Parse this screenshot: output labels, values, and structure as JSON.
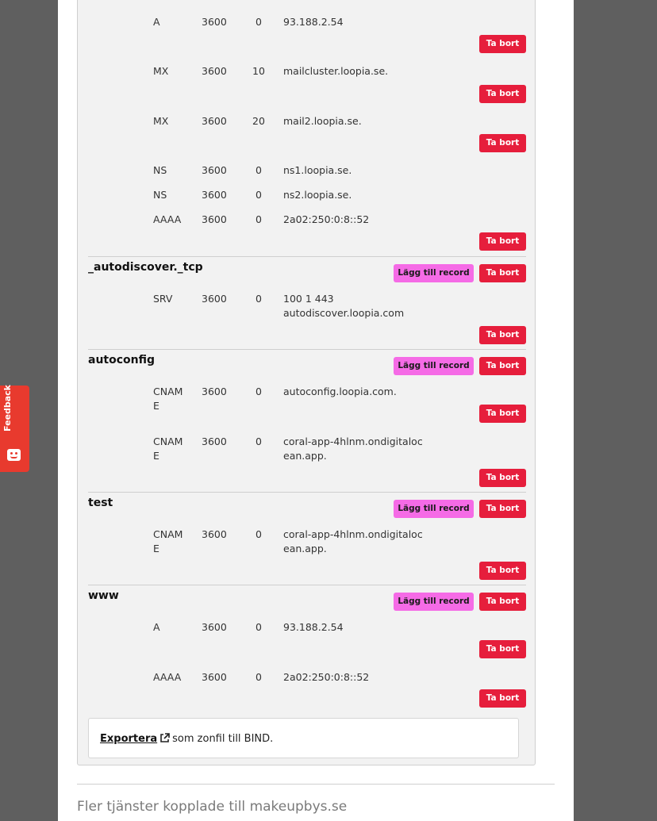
{
  "labels": {
    "delete_button": "Ta bort",
    "add_record_button": "Lägg till record"
  },
  "records_top": [
    {
      "type": "A",
      "ttl": "3600",
      "prio": "0",
      "data": "93.188.2.54"
    },
    {
      "type": "MX",
      "ttl": "3600",
      "prio": "10",
      "data": "mailcluster.loopia.se."
    },
    {
      "type": "MX",
      "ttl": "3600",
      "prio": "20",
      "data": "mail2.loopia.se."
    },
    {
      "type": "NS",
      "ttl": "3600",
      "prio": "0",
      "data": "ns1.loopia.se."
    },
    {
      "type": "NS",
      "ttl": "3600",
      "prio": "0",
      "data": "ns2.loopia.se."
    },
    {
      "type": "AAAA",
      "ttl": "3600",
      "prio": "0",
      "data": "2a02:250:0:8::52"
    }
  ],
  "zones": [
    {
      "name": "_autodiscover._tcp",
      "records": [
        {
          "type": "SRV",
          "ttl": "3600",
          "prio": "0",
          "data": "100 1 443 autodiscover.loopia.com"
        }
      ]
    },
    {
      "name": "autoconfig",
      "records": [
        {
          "type": "CNAME",
          "ttl": "3600",
          "prio": "0",
          "data": "autoconfig.loopia.com."
        },
        {
          "type": "CNAME",
          "ttl": "3600",
          "prio": "0",
          "data": "coral-app-4hlnm.ondigitalocean.app."
        }
      ]
    },
    {
      "name": "test",
      "records": [
        {
          "type": "CNAME",
          "ttl": "3600",
          "prio": "0",
          "data": "coral-app-4hlnm.ondigitalocean.app."
        }
      ]
    },
    {
      "name": "www",
      "records": [
        {
          "type": "A",
          "ttl": "3600",
          "prio": "0",
          "data": "93.188.2.54"
        },
        {
          "type": "AAAA",
          "ttl": "3600",
          "prio": "0",
          "data": "2a02:250:0:8::52"
        }
      ]
    }
  ],
  "export": {
    "link_text": "Exportera",
    "suffix": "som zonfil till BIND."
  },
  "more_services_heading": "Fler tjänster kopplade till makeupbys.se",
  "feedback": {
    "label": "Feedback"
  },
  "colors": {
    "delete": "#e61e3c",
    "add": "#f56be6",
    "feedback": "#e83a2e"
  }
}
